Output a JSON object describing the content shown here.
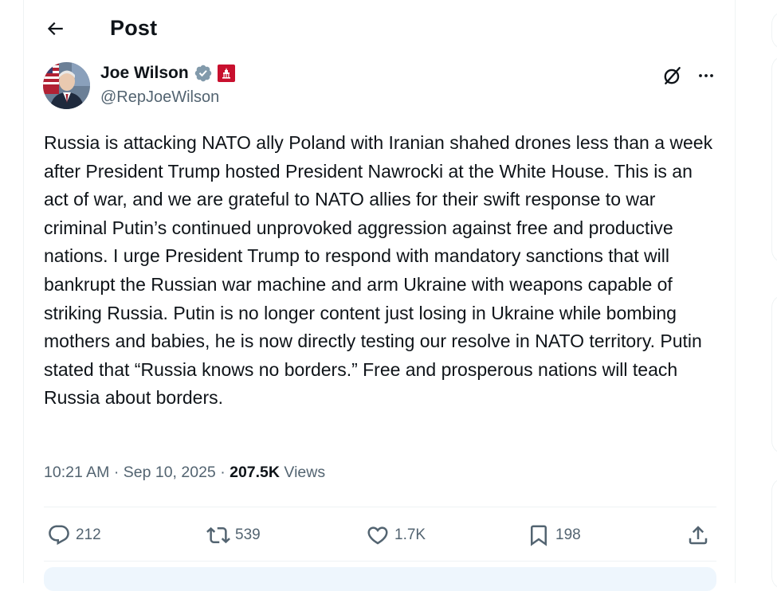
{
  "header": {
    "title": "Post"
  },
  "author": {
    "name": "Joe Wilson",
    "handle": "@RepJoeWilson"
  },
  "post": {
    "text": "Russia is attacking NATO ally Poland with Iranian shahed drones less than a week after President Trump hosted President Nawrocki at the White House. This is an act of war, and we are grateful to NATO allies for their swift response to war criminal Putin’s continued unprovoked aggression against free and productive nations. I urge President Trump to respond with mandatory sanctions that will bankrupt the Russian war machine and arm Ukraine with weapons capable of striking Russia. Putin is no longer content just losing in Ukraine while bombing mothers and babies, he is now directly testing our resolve in NATO territory. Putin stated that “Russia knows no borders.” Free and prosperous nations will teach Russia about borders.",
    "time": "10:21 AM",
    "date": "Sep 10, 2025",
    "separator": "·",
    "views_count": "207.5K",
    "views_label": "Views"
  },
  "actions": {
    "replies": "212",
    "reposts": "539",
    "likes": "1.7K",
    "bookmarks": "198"
  },
  "icons": {
    "back": "arrow-left-icon",
    "verified": "verified-badge-icon",
    "affiliation": "congress-flag-icon",
    "grok": "grok-icon",
    "more": "more-icon",
    "reply": "reply-icon",
    "repost": "repost-icon",
    "like": "like-icon",
    "bookmark": "bookmark-icon",
    "share": "share-icon"
  },
  "colors": {
    "text": "#0f1419",
    "secondary": "#536471",
    "verified_gray": "#829aab",
    "affiliation_red": "#c8102e",
    "divider": "#eff3f4"
  }
}
